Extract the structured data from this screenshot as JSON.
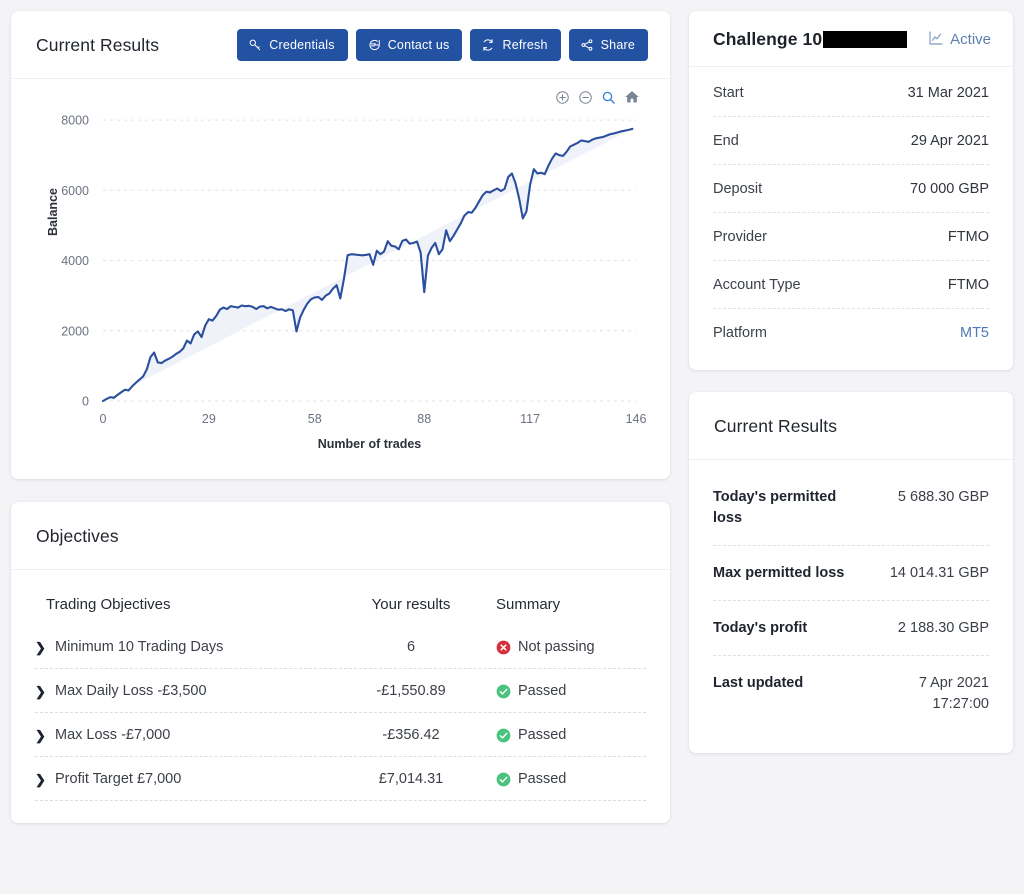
{
  "results_card": {
    "title": "Current Results",
    "buttons": [
      {
        "label": "Credentials",
        "icon": "key-icon"
      },
      {
        "label": "Contact us",
        "icon": "chat-icon"
      },
      {
        "label": "Refresh",
        "icon": "refresh-icon"
      },
      {
        "label": "Share",
        "icon": "share-icon"
      }
    ],
    "chart_tools": [
      {
        "name": "zoom-in-icon"
      },
      {
        "name": "zoom-out-icon"
      },
      {
        "name": "selection-zoom-icon"
      },
      {
        "name": "home-reset-icon"
      }
    ]
  },
  "chart_data": {
    "type": "area",
    "title": "",
    "xlabel": "Number of trades",
    "ylabel": "Balance",
    "xticks": [
      0,
      29,
      58,
      88,
      117,
      146
    ],
    "yticks": [
      0,
      2000,
      4000,
      6000,
      8000
    ],
    "xlim": [
      0,
      146
    ],
    "ylim": [
      0,
      8600
    ],
    "grid": true,
    "legend": false,
    "line_color": "#2a4f9e",
    "fill_color": "#eff2f8",
    "series": [
      {
        "name": "Balance",
        "x": [
          0,
          1,
          2,
          3,
          4,
          5,
          6,
          7,
          8,
          9,
          10,
          11,
          12,
          13,
          14,
          15,
          16,
          17,
          18,
          19,
          20,
          21,
          22,
          23,
          24,
          25,
          26,
          27,
          28,
          29,
          30,
          31,
          32,
          33,
          34,
          35,
          36,
          37,
          38,
          39,
          40,
          41,
          42,
          43,
          44,
          45,
          46,
          47,
          48,
          49,
          50,
          51,
          52,
          53,
          54,
          55,
          56,
          57,
          58,
          59,
          60,
          61,
          62,
          63,
          64,
          65,
          66,
          67,
          68,
          69,
          70,
          71,
          72,
          73,
          74,
          75,
          76,
          77,
          78,
          79,
          80,
          81,
          82,
          83,
          84,
          85,
          86,
          87,
          88,
          89,
          90,
          91,
          92,
          93,
          94,
          95,
          96,
          97,
          98,
          99,
          100,
          101,
          102,
          103,
          104,
          105,
          106,
          107,
          108,
          109,
          110,
          111,
          112,
          113,
          114,
          115,
          116,
          117,
          118,
          119,
          120,
          121,
          122,
          123,
          124,
          125,
          126,
          127,
          128,
          129,
          130,
          131,
          132,
          133,
          134,
          135,
          136,
          137,
          138,
          139,
          140,
          141,
          142,
          143,
          144,
          145,
          146
        ],
        "values": [
          0,
          60,
          110,
          90,
          175,
          250,
          320,
          300,
          420,
          520,
          610,
          700,
          900,
          1250,
          1380,
          1100,
          1080,
          1150,
          1200,
          1260,
          1340,
          1400,
          1500,
          1720,
          1640,
          1900,
          1980,
          1820,
          2150,
          2330,
          2290,
          2420,
          2600,
          2660,
          2620,
          2700,
          2680,
          2660,
          2720,
          2700,
          2710,
          2680,
          2620,
          2690,
          2700,
          2640,
          2680,
          2640,
          2600,
          2610,
          2560,
          2610,
          2580,
          1980,
          2380,
          2600,
          2780,
          2900,
          2950,
          2960,
          2880,
          3000,
          3060,
          3200,
          3300,
          2920,
          3480,
          4150,
          4180,
          4170,
          4160,
          4150,
          4160,
          4180,
          3880,
          4280,
          4180,
          4260,
          4550,
          4420,
          4400,
          4320,
          4560,
          4600,
          4480,
          4500,
          4540,
          4230,
          3100,
          4140,
          4360,
          4500,
          4180,
          4320,
          4860,
          4550,
          4700,
          4880,
          5060,
          5280,
          5380,
          5360,
          5500,
          5680,
          5860,
          5960,
          5940,
          6000,
          6050,
          5980,
          6040,
          6380,
          6480,
          6200,
          5760,
          5200,
          5400,
          6160,
          6600,
          6480,
          6500,
          6460,
          6700,
          6900,
          7050,
          7000,
          6980,
          7100,
          7250,
          7300,
          7350,
          7420,
          7400,
          7380,
          7440,
          7480,
          7500,
          7520,
          7560,
          7600,
          7620,
          7650,
          7680,
          7700,
          7720,
          7750
        ]
      }
    ]
  },
  "objectives_card": {
    "title": "Objectives",
    "columns": [
      "Trading Objectives",
      "Your results",
      "Summary"
    ],
    "rows": [
      {
        "objective": "Minimum 10 Trading Days",
        "result": "6",
        "status": "Not passing",
        "state": "fail"
      },
      {
        "objective": "Max Daily Loss -£3,500",
        "result": "-£1,550.89",
        "status": "Passed",
        "state": "pass"
      },
      {
        "objective": "Max Loss -£7,000",
        "result": "-£356.42",
        "status": "Passed",
        "state": "pass"
      },
      {
        "objective": "Profit Target £7,000",
        "result": "£7,014.31",
        "status": "Passed",
        "state": "pass"
      }
    ]
  },
  "challenge_card": {
    "title": "Challenge 10",
    "title_redacted": true,
    "status": "Active",
    "rows": [
      {
        "key": "Start",
        "value": "31 Mar 2021"
      },
      {
        "key": "End",
        "value": "29 Apr 2021"
      },
      {
        "key": "Deposit",
        "value": "70 000 GBP"
      },
      {
        "key": "Provider",
        "value": "FTMO"
      },
      {
        "key": "Account Type",
        "value": "FTMO"
      },
      {
        "key": "Platform",
        "value": "MT5",
        "link": true
      }
    ]
  },
  "current_results_card": {
    "title": "Current Results",
    "rows": [
      {
        "key": "Today's permitted loss",
        "value": "5 688.30 GBP"
      },
      {
        "key": "Max permitted loss",
        "value": "14 014.31 GBP"
      },
      {
        "key": "Today's profit",
        "value": "2 188.30 GBP"
      },
      {
        "key": "Last updated",
        "value": "7 Apr 2021\n17:27:00"
      }
    ]
  },
  "colors": {
    "button_blue": "#2452a3",
    "line_blue": "#2a4f9e",
    "pass_green": "#49c37e",
    "fail_red": "#d32f3c",
    "link_blue": "#4d79b8",
    "background": "#f4f4f7"
  }
}
